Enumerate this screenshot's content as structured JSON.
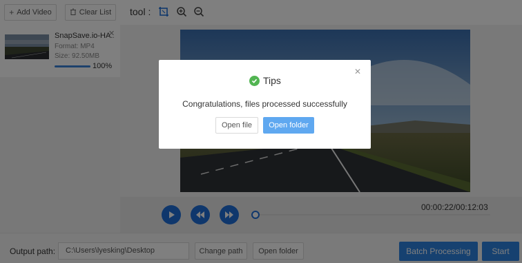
{
  "toolbar": {
    "add_video_label": "Add Video",
    "clear_list_label": "Clear List",
    "tool_label": "tool :"
  },
  "file_list": [
    {
      "name": "SnapSave.io-HA...",
      "format": "Format:  MP4",
      "size": "Size:  92.50MB",
      "progress": 1.0,
      "progress_label": "100%"
    }
  ],
  "player": {
    "time": "00:00:22/00:12:03",
    "position": 0.03
  },
  "bottom": {
    "output_label": "Output path:",
    "output_path": "C:\\Users\\lyesking\\Desktop",
    "change_path_label": "Change path",
    "open_folder_label": "Open folder",
    "batch_label": "Batch Processing",
    "start_label": "Start"
  },
  "dialog": {
    "title": "Tips",
    "message": "Congratulations, files processed successfully",
    "open_file_label": "Open file",
    "open_folder_label": "Open folder"
  },
  "colors": {
    "accent": "#2c82e0",
    "success": "#52b552",
    "dialog_primary": "#5fa8f0"
  },
  "icons": {
    "add": "plus-icon",
    "clear": "trash-icon",
    "crop": "crop-icon",
    "zoom_in": "zoom-in-icon",
    "zoom_out": "zoom-out-icon",
    "play": "play-icon",
    "rewind": "rewind-icon",
    "forward": "fast-forward-icon",
    "close": "close-icon",
    "success": "check-circle-icon"
  }
}
